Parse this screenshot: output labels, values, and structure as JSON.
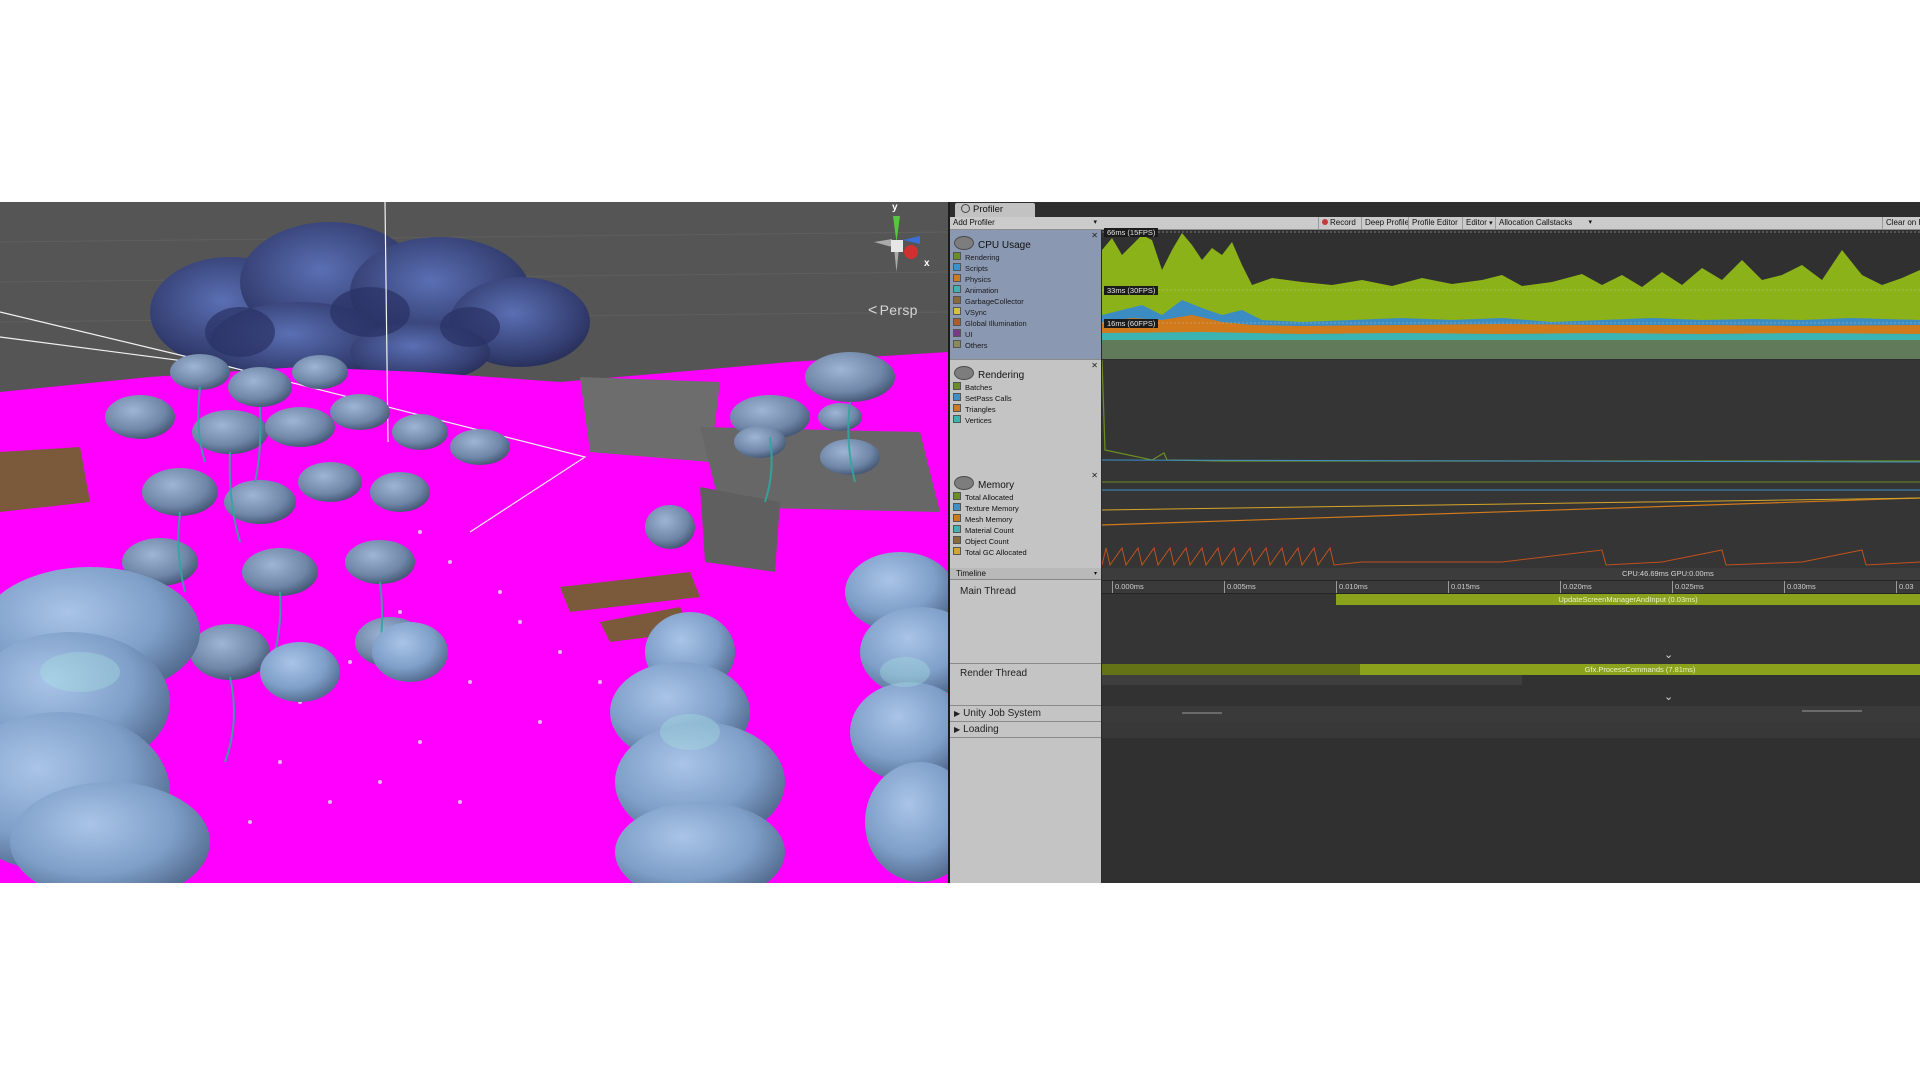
{
  "scene": {
    "view_mode_label": "Persp",
    "gizmo_axes": {
      "y": "y",
      "x": "x"
    }
  },
  "profiler": {
    "tab_title": "Profiler",
    "toolbar": {
      "add_profiler": "Add Profiler",
      "record": "Record",
      "deep_profile": "Deep Profile",
      "profile_editor": "Profile Editor",
      "editor": "Editor",
      "allocation_callstacks": "Allocation Callstacks",
      "clear_on": "Clear on P"
    },
    "modules": {
      "cpu": {
        "title": "CPU Usage",
        "items": [
          {
            "label": "Rendering",
            "color": "#6b8e23"
          },
          {
            "label": "Scripts",
            "color": "#3c91c8"
          },
          {
            "label": "Physics",
            "color": "#d07a1c"
          },
          {
            "label": "Animation",
            "color": "#3bb3b3"
          },
          {
            "label": "GarbageCollector",
            "color": "#8b6a3a"
          },
          {
            "label": "VSync",
            "color": "#d4c239"
          },
          {
            "label": "Global Illumination",
            "color": "#b05b2a"
          },
          {
            "label": "UI",
            "color": "#7a3a8a"
          },
          {
            "label": "Others",
            "color": "#8a8a5a"
          }
        ],
        "thresholds": [
          "66ms (15FPS)",
          "33ms (30FPS)",
          "16ms (60FPS)"
        ]
      },
      "rendering": {
        "title": "Rendering",
        "items": [
          {
            "label": "Batches",
            "color": "#6b8e23"
          },
          {
            "label": "SetPass Calls",
            "color": "#3c91c8"
          },
          {
            "label": "Triangles",
            "color": "#d07a1c"
          },
          {
            "label": "Vertices",
            "color": "#3bb3b3"
          }
        ]
      },
      "memory": {
        "title": "Memory",
        "items": [
          {
            "label": "Total Allocated",
            "color": "#6b8e23"
          },
          {
            "label": "Texture Memory",
            "color": "#3c91c8"
          },
          {
            "label": "Mesh Memory",
            "color": "#d07a1c"
          },
          {
            "label": "Material Count",
            "color": "#3bb3b3"
          },
          {
            "label": "Object Count",
            "color": "#8b6a3a"
          },
          {
            "label": "Total GC Allocated",
            "color": "#d4a52a"
          }
        ]
      }
    },
    "timeline": {
      "mode_label": "Timeline",
      "cpu_gpu": "CPU:46.69ms   GPU:0.00ms",
      "ticks": [
        "0.000ms",
        "0.005ms",
        "0.010ms",
        "0.015ms",
        "0.020ms",
        "0.025ms",
        "0.030ms",
        "0.03"
      ],
      "threads": {
        "main": "Main Thread",
        "render": "Render Thread",
        "job": "Unity Job System",
        "loading": "Loading"
      },
      "markers": {
        "main": "UpdateScreenManagerAndInput (0.03ms)",
        "render": "Gfx.ProcessCommands (7.81ms)"
      }
    }
  }
}
